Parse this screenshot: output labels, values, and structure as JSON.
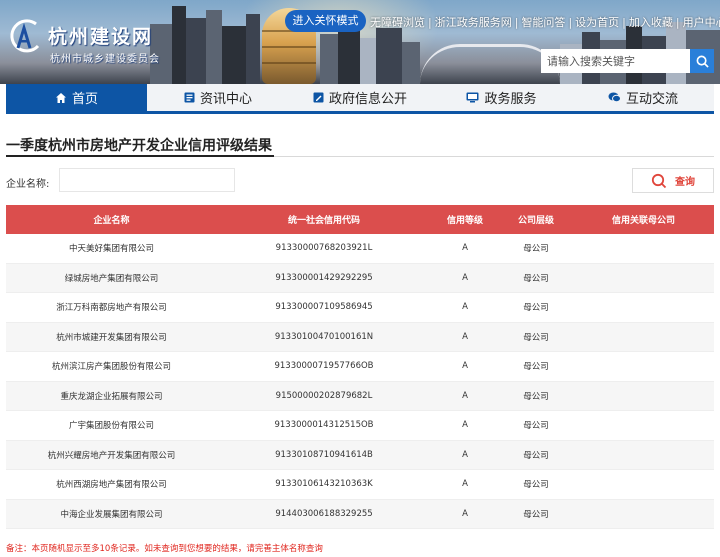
{
  "header": {
    "logo_title": "杭州建设网",
    "logo_subtitle": "杭州市城乡建设委员会",
    "care_mode_button": "进入关怀模式",
    "top_links": [
      "无障碍浏览",
      "浙江政务服务网",
      "智能问答",
      "设为首页",
      "加入收藏",
      "用户中心"
    ],
    "search": {
      "placeholder": "请输入搜索关键字",
      "value": ""
    }
  },
  "nav": {
    "items": [
      {
        "label": "首页",
        "icon": "home-icon",
        "active": true
      },
      {
        "label": "资讯中心",
        "icon": "news-icon",
        "active": false
      },
      {
        "label": "政府信息公开",
        "icon": "document-icon",
        "active": false
      },
      {
        "label": "政务服务",
        "icon": "monitor-icon",
        "active": false
      },
      {
        "label": "互动交流",
        "icon": "chat-icon",
        "active": false
      }
    ]
  },
  "page": {
    "title": "一季度杭州市房地产开发企业信用评级结果",
    "filter_label": "企业名称:",
    "filter_value": "",
    "query_button": "查询"
  },
  "table": {
    "headers": [
      "企业名称",
      "统一社会信用代码",
      "信用等级",
      "公司层级",
      "信用关联母公司"
    ],
    "rows": [
      [
        "中天美好集团有限公司",
        "91330000768203921L",
        "A",
        "母公司",
        ""
      ],
      [
        "绿城房地产集团有限公司",
        "913300001429292295",
        "A",
        "母公司",
        ""
      ],
      [
        "浙江万科南都房地产有限公司",
        "913300007109586945",
        "A",
        "母公司",
        ""
      ],
      [
        "杭州市城建开发集团有限公司",
        "91330100470100161N",
        "A",
        "母公司",
        ""
      ],
      [
        "杭州滨江房产集团股份有限公司",
        "9133000071957766OB",
        "A",
        "母公司",
        ""
      ],
      [
        "重庆龙湖企业拓展有限公司",
        "91500000202879682L",
        "A",
        "母公司",
        ""
      ],
      [
        "广宇集团股份有限公司",
        "9133000014312515OB",
        "A",
        "母公司",
        ""
      ],
      [
        "杭州兴耀房地产开发集团有限公司",
        "91330108710941614B",
        "A",
        "母公司",
        ""
      ],
      [
        "杭州西湖房地产集团有限公司",
        "91330106143210363K",
        "A",
        "母公司",
        ""
      ],
      [
        "中海企业发展集团有限公司",
        "914403006188329255",
        "A",
        "母公司",
        ""
      ]
    ]
  },
  "footer_note": "备注：本页随机显示至多10条记录。如未查询到您想要的结果，请完善主体名称查询",
  "colors": {
    "nav_blue": "#0d55a5",
    "table_header_red": "#db4e4d",
    "note_red": "#e0271f",
    "care_btn_blue": "#1a63c2"
  }
}
